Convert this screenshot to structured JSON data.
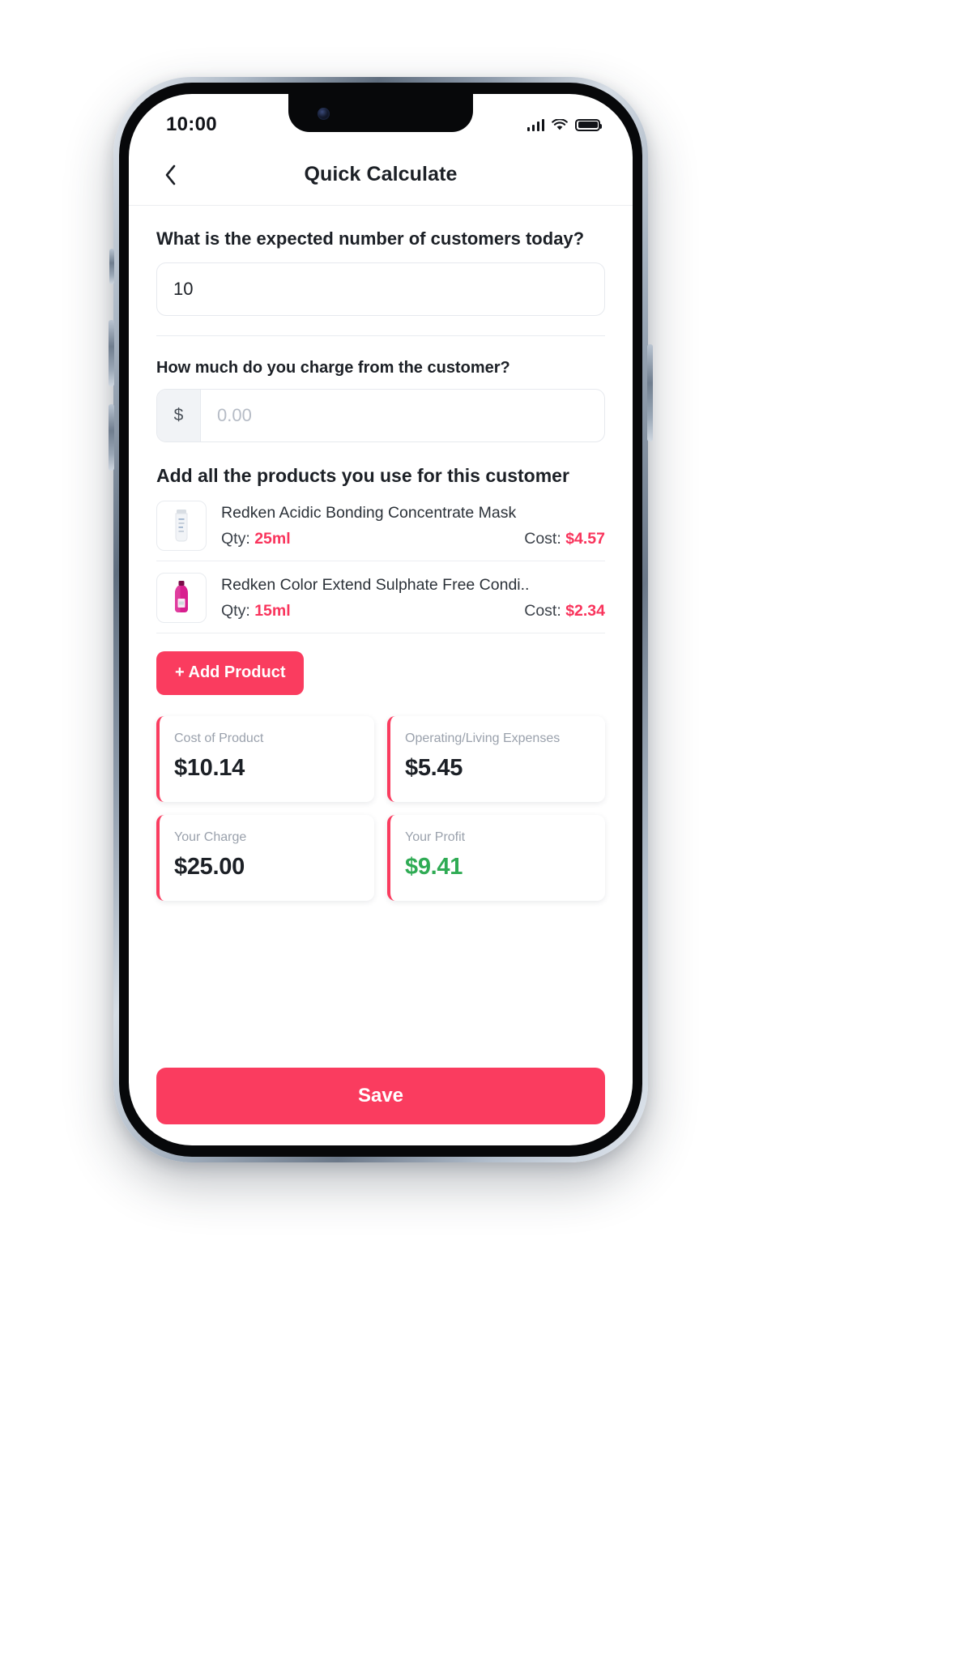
{
  "status_bar": {
    "time": "10:00",
    "signal_icon": "cellular-signal-icon",
    "wifi_icon": "wifi-icon",
    "battery_icon": "battery-full-icon"
  },
  "header": {
    "back_icon": "chevron-left-icon",
    "title": "Quick Calculate"
  },
  "form": {
    "customers_question": "What is the expected number of customers today?",
    "customers_value": "10",
    "charge_question": "How much do you charge from the customer?",
    "charge_currency_symbol": "$",
    "charge_placeholder": "0.00",
    "charge_value": ""
  },
  "products_section": {
    "title": "Add all the products you use for this customer",
    "qty_label": "Qty:",
    "cost_label": "Cost:",
    "add_button_label": "+ Add Product",
    "items": [
      {
        "name": "Redken Acidic Bonding Concentrate Mask",
        "qty": "25ml",
        "cost": "$4.57",
        "thumb_icon": "product-tube-icon"
      },
      {
        "name": "Redken Color Extend Sulphate Free Condi..",
        "qty": "15ml",
        "cost": "$2.34",
        "thumb_icon": "product-bottle-icon"
      }
    ]
  },
  "summary": {
    "cards": [
      {
        "label": "Cost of Product",
        "value": "$10.14",
        "value_color": "#1c2026"
      },
      {
        "label": "Operating/Living Expenses",
        "value": "$5.45",
        "value_color": "#1c2026"
      },
      {
        "label": "Your Charge",
        "value": "$25.00",
        "value_color": "#1c2026"
      },
      {
        "label": "Your Profit",
        "value": "$9.41",
        "value_color": "#2fab54"
      }
    ]
  },
  "footer": {
    "save_label": "Save"
  },
  "colors": {
    "accent": "#fa3c5f",
    "accent_text": "#f9345c",
    "profit_green": "#2fab54",
    "text_primary": "#1c2026",
    "text_muted": "#9aa1ac"
  }
}
